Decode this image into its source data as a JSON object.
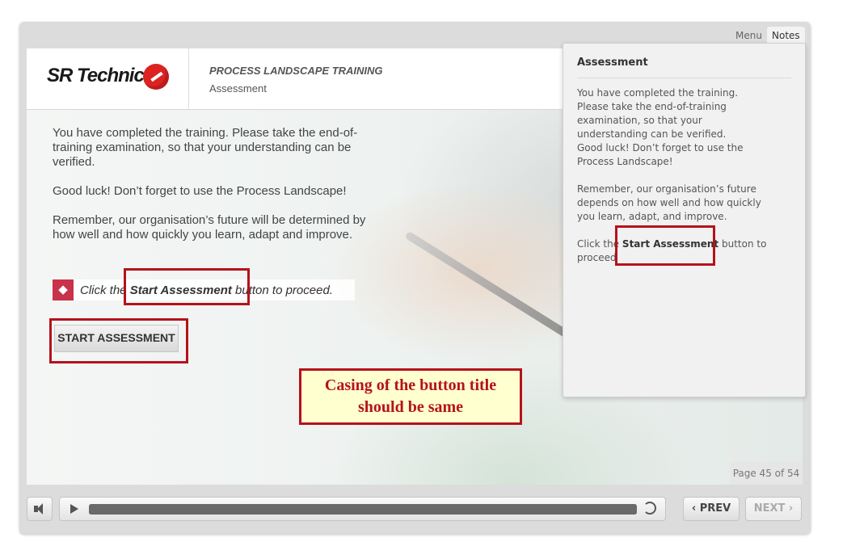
{
  "player": {
    "tabs": {
      "menu": "Menu",
      "notes": "Notes"
    },
    "page_indicator": "Page 45 of 54"
  },
  "header": {
    "logo_text": "SR Technics",
    "course_title": "PROCESS LANDSCAPE TRAINING",
    "section": "Assessment"
  },
  "slide": {
    "para1": "You have completed the training. Please take the end-of-training examination, so that your understanding can be verified.",
    "para2": "Good luck! Don’t forget to use the Process Landscape!",
    "para3": "Remember, our organisation’s future will be determined by how well and how quickly you learn, adapt and improve.",
    "instruction_pre": "Click the ",
    "instruction_bold": "Start Assessment",
    "instruction_post": " button to proceed.",
    "start_button": "START ASSESSMENT"
  },
  "notes": {
    "title": "Assessment",
    "p1": "You have completed the training. Please take the end-of-training examination, so that your understanding can be verified.",
    "p2": "Good luck! Don’t forget to use the Process Landscape!",
    "p3": "Remember, our organisation’s future depends on how well and how quickly you learn, adapt, and improve.",
    "p4_pre": "Click the ",
    "p4_bold": "Start Assessment",
    "p4_post": " button to proceed"
  },
  "controls": {
    "prev": "PREV",
    "next": "NEXT",
    "progress": 1.0,
    "icons": [
      "volume-icon",
      "play-icon",
      "replay-icon",
      "chevron-left-icon",
      "chevron-right-icon"
    ]
  },
  "annotation": {
    "line1": "Casing of the button title",
    "line2": "should be same",
    "color": "#b5121b"
  }
}
